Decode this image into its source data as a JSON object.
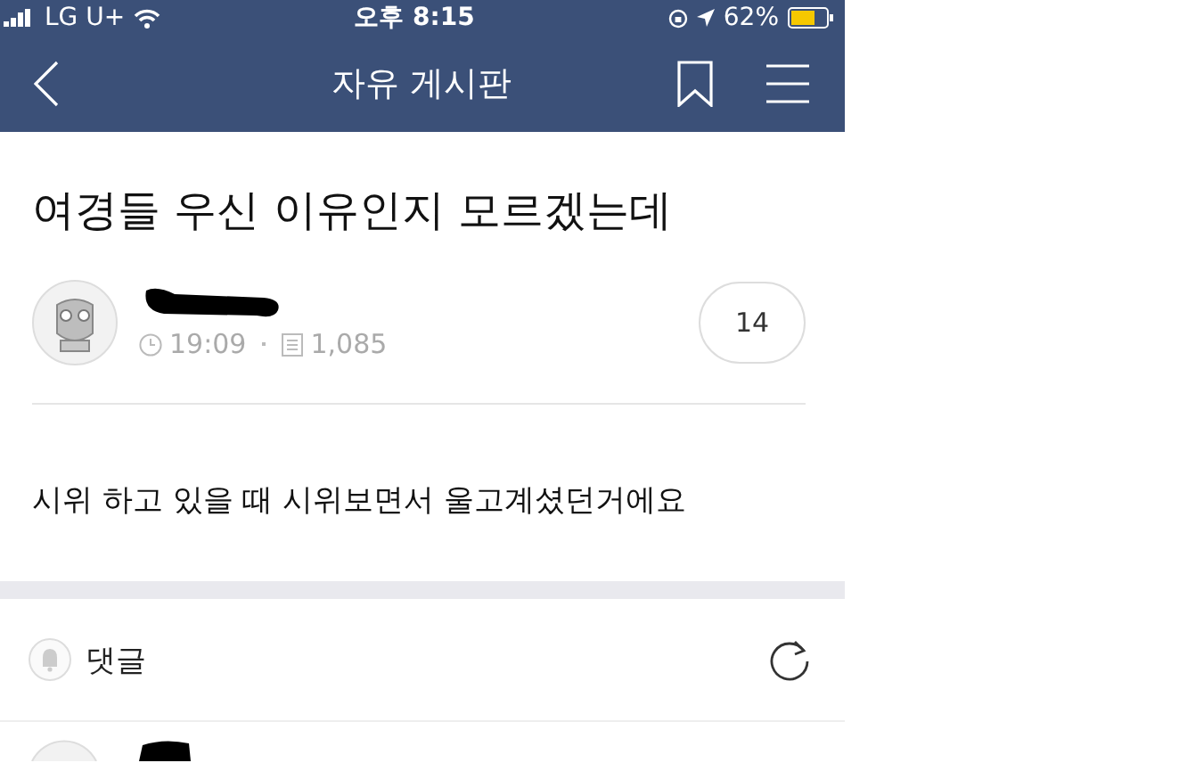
{
  "status_bar": {
    "carrier": "LG U+",
    "time": "오후 8:15",
    "battery": "62%"
  },
  "nav": {
    "title": "자유 게시판"
  },
  "post": {
    "title": "여경들 우신 이유인지 모르겠는데",
    "time": "19:09",
    "views": "1,085",
    "comment_count": "14",
    "body": "시위 하고 있을 때 시위보면서 울고계셨던거에요"
  },
  "comments": {
    "label": "댓글"
  }
}
